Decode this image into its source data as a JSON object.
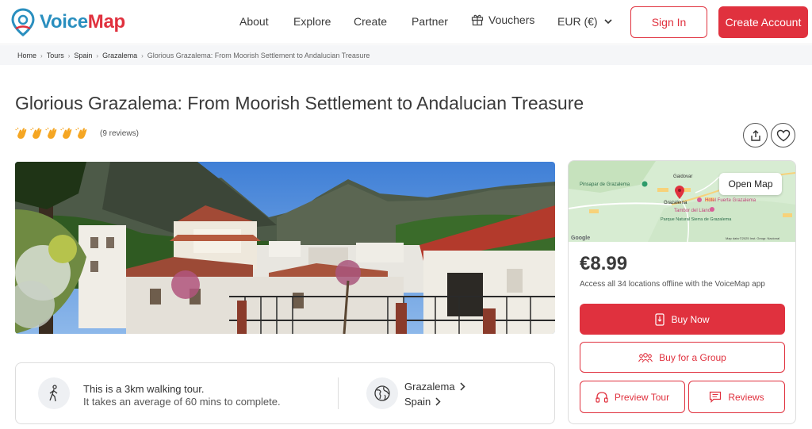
{
  "brand": {
    "name_part1": "Voice",
    "name_part2": "Map"
  },
  "nav": {
    "about": "About",
    "explore": "Explore",
    "create": "Create",
    "partner": "Partner",
    "vouchers": "Vouchers",
    "currency": "EUR (€)"
  },
  "auth": {
    "sign_in": "Sign In",
    "create_account": "Create Account"
  },
  "breadcrumb": [
    "Home",
    "Tours",
    "Spain",
    "Grazalema",
    "Glorious Grazalema: From Moorish Settlement to Andalucian Treasure"
  ],
  "tour": {
    "title": "Glorious Grazalema: From Moorish Settlement to Andalucian Treasure",
    "rating": 5,
    "reviews_text": "(9 reviews)"
  },
  "info": {
    "walk_line1": "This is a 3km walking tour.",
    "walk_line2": "It takes an average of 60 mins to complete.",
    "city": "Grazalema",
    "country": "Spain"
  },
  "map": {
    "open_map": "Open Map",
    "labels": {
      "pinsapar": "Pinsapar de Grazalema",
      "gaidovar": "Gaidovar",
      "grazalema": "Grazalema",
      "hotel": "Hotel Fuerte Grazalema",
      "tambor": "Tambor del Llano",
      "parque": "Parque Natural Sierra de Grazalema",
      "google": "Google",
      "attribution": "Map data ©2025 Inst. Geogr. Nacional"
    }
  },
  "purchase": {
    "price": "€8.99",
    "price_sub": "Access all 34 locations offline with the VoiceMap app",
    "buy_now": "Buy Now",
    "buy_group": "Buy for a Group",
    "preview": "Preview Tour",
    "reviews": "Reviews"
  },
  "colors": {
    "brand_red": "#e0313e",
    "brand_blue": "#2a8fbf"
  }
}
